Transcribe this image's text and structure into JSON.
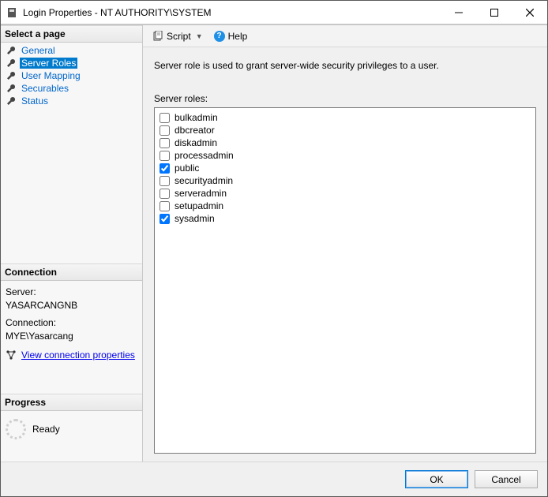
{
  "window": {
    "title": "Login Properties - NT AUTHORITY\\SYSTEM"
  },
  "left": {
    "select_header": "Select a page",
    "pages": [
      {
        "label": "General"
      },
      {
        "label": "Server Roles"
      },
      {
        "label": "User Mapping"
      },
      {
        "label": "Securables"
      },
      {
        "label": "Status"
      }
    ],
    "connection_header": "Connection",
    "server_label": "Server:",
    "server_value": "YASARCANGNB",
    "connection_label": "Connection:",
    "connection_value": "MYE\\Yasarcang",
    "view_conn_link": "View connection properties",
    "progress_header": "Progress",
    "progress_status": "Ready"
  },
  "toolbar": {
    "script_label": "Script",
    "help_label": "Help"
  },
  "main": {
    "description": "Server role is used to grant server-wide security privileges to a user.",
    "roles_label": "Server roles:",
    "roles": [
      {
        "name": "bulkadmin",
        "checked": false
      },
      {
        "name": "dbcreator",
        "checked": false
      },
      {
        "name": "diskadmin",
        "checked": false
      },
      {
        "name": "processadmin",
        "checked": false
      },
      {
        "name": "public",
        "checked": true
      },
      {
        "name": "securityadmin",
        "checked": false
      },
      {
        "name": "serveradmin",
        "checked": false
      },
      {
        "name": "setupadmin",
        "checked": false
      },
      {
        "name": "sysadmin",
        "checked": true
      }
    ]
  },
  "buttons": {
    "ok": "OK",
    "cancel": "Cancel"
  }
}
